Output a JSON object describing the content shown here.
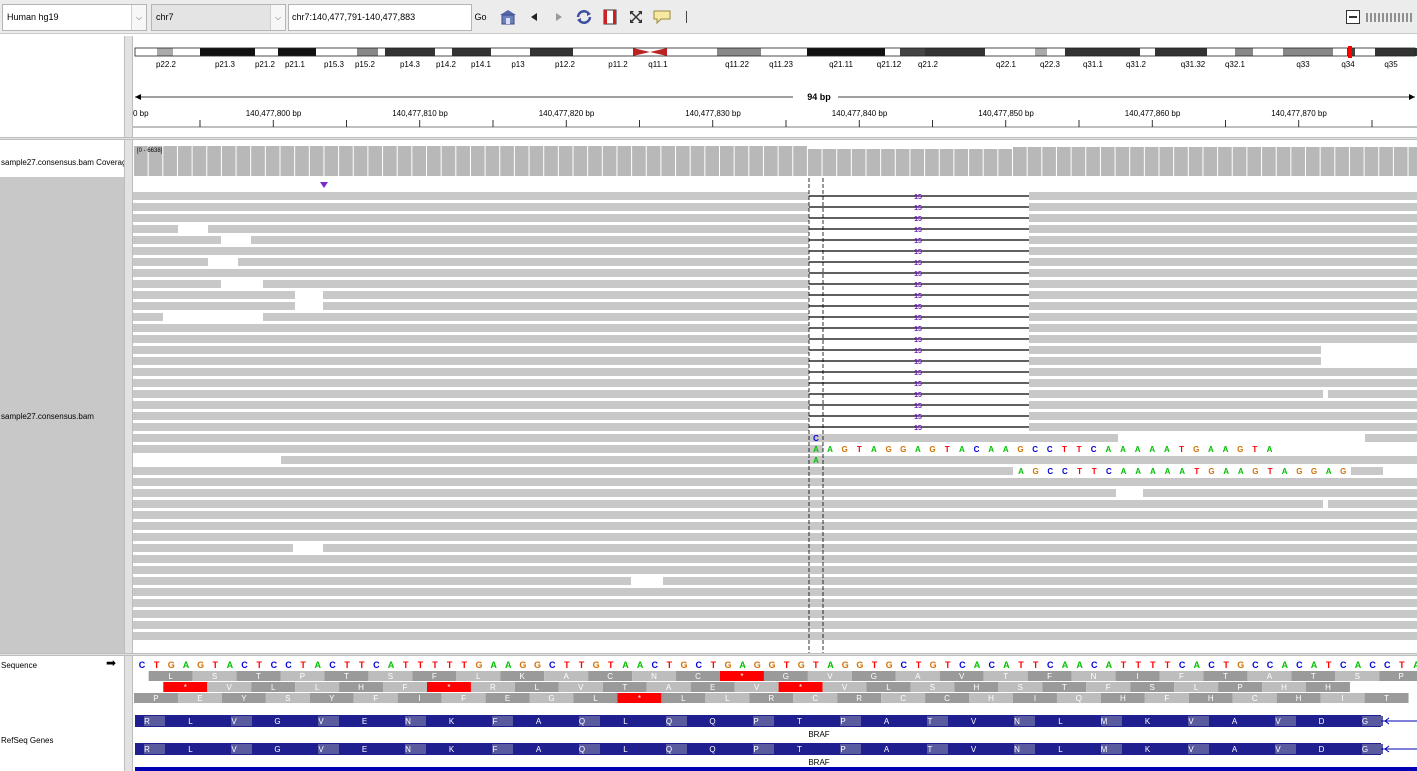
{
  "toolbar": {
    "genome": "Human hg19",
    "chromosome": "chr7",
    "locus": "chr7:140,477,791-140,477,883",
    "go_label": "Go",
    "icons": [
      "home-icon",
      "back-arrow-icon",
      "forward-arrow-icon",
      "refresh-icon",
      "roi-icon",
      "resize-icon",
      "popup-text-icon"
    ]
  },
  "ideogram": {
    "bands": [
      "p22.2",
      "p21.3",
      "p21.2",
      "p21.1",
      "p15.3",
      "p15.2",
      "p14.3",
      "p14.2",
      "p14.1",
      "p13",
      "p12.2",
      "p11.2",
      "q11.1",
      "q11.22",
      "q11.23",
      "q21.11",
      "q21.12",
      "q21.2",
      "q22.1",
      "q22.3",
      "q31.1",
      "q31.2",
      "q31.32",
      "q32.1",
      "q33",
      "q34",
      "q35"
    ]
  },
  "ruler": {
    "span_label": "94 bp",
    "first_label": "0 bp",
    "tick_labels": [
      "140,477,800 bp",
      "140,477,810 bp",
      "140,477,820 bp",
      "140,477,830 bp",
      "140,477,840 bp",
      "140,477,850 bp",
      "140,477,860 bp",
      "140,477,870 bp"
    ]
  },
  "tracks": {
    "coverage_label": "sample27.consensus.bam Coverage",
    "coverage_range": "[0 - 6638]",
    "alignment_label": "sample27.consensus.bam",
    "sequence_label": "Sequence",
    "sequence_arrow": "➡",
    "refseq_label": "RefSeq Genes"
  },
  "alignments": {
    "deletion_length": "15",
    "insertion_base": "C",
    "softclip_read1": "AGTAGGAGTACAAGCCTTCAAAAATGAAGTA",
    "softclip_read2": "AGCCTTCAAAAATGAAGTAGGAG",
    "mismatch_bases": [
      "A",
      "A"
    ]
  },
  "sequence": {
    "bases": "CTGAGTACTCCTACTTCATTTTTGAAGGCTTGTAACTGCTGAGGTGTAGGTGCTGTCACATTCAACATTTTCACTGCCACATCACCTA",
    "frame1": [
      "L",
      "S",
      "T",
      "P",
      "T",
      "S",
      "F",
      "L",
      "K",
      "A",
      "C",
      "N",
      "C",
      "*",
      "G",
      "V",
      "G",
      "A",
      "V",
      "T",
      "F",
      "N",
      "I",
      "F",
      "T",
      "A",
      "T",
      "S",
      "P"
    ],
    "frame2": [
      "*",
      "V",
      "L",
      "L",
      "H",
      "F",
      "*",
      "R",
      "L",
      "V",
      "T",
      "A",
      "E",
      "V",
      "*",
      "V",
      "L",
      "S",
      "H",
      "S",
      "T",
      "F",
      "S",
      "L",
      "P",
      "H",
      "H"
    ],
    "frame3": [
      "P",
      "E",
      "Y",
      "S",
      "Y",
      "F",
      "I",
      "F",
      "E",
      "G",
      "L",
      "*",
      "L",
      "L",
      "R",
      "C",
      "R",
      "C",
      "C",
      "H",
      "I",
      "Q",
      "H",
      "F",
      "H",
      "C",
      "H",
      "I",
      "T"
    ]
  },
  "genes": {
    "gene_name": "BRAF",
    "exon_aminos": [
      "R",
      "L",
      "V",
      "G",
      "V",
      "E",
      "N",
      "K",
      "F",
      "A",
      "Q",
      "L",
      "Q",
      "Q",
      "P",
      "T",
      "P",
      "A",
      "T",
      "V",
      "N",
      "L",
      "M",
      "K",
      "V",
      "A",
      "V",
      "D",
      "G"
    ],
    "colors": {
      "exon": "#1f1f8f",
      "exon_alt": "#5a5a9e",
      "transcript": "#0000b2"
    }
  },
  "colors": {
    "A": "#00c000",
    "C": "#0000e0",
    "G": "#d17105",
    "T": "#ff0000",
    "read": "#c8c8c8",
    "deletion_text": "#6a1cb5",
    "stop": "#ff0000"
  }
}
